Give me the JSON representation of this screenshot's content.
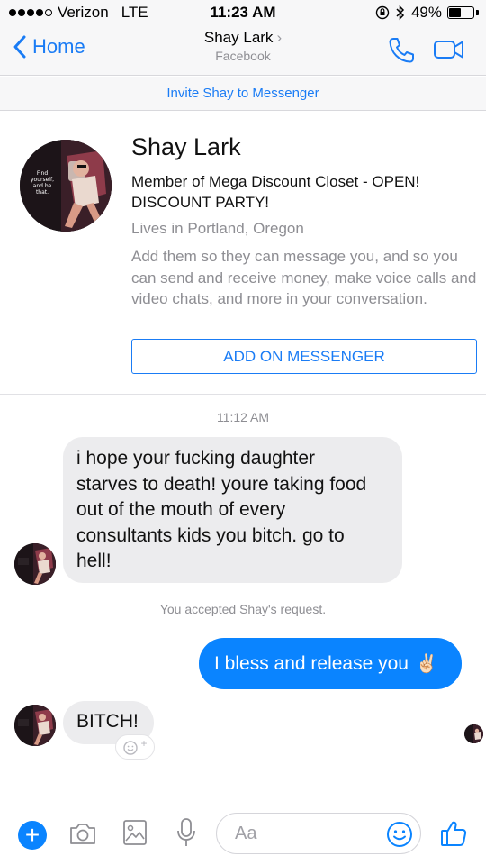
{
  "status_bar": {
    "carrier": "Verizon",
    "network": "LTE",
    "time": "11:23 AM",
    "battery_percent": "49%",
    "battery_level": 0.49,
    "signal_bars_filled": 4
  },
  "nav": {
    "back_label": "Home",
    "title": "Shay Lark",
    "chevron": "›",
    "subtitle": "Facebook",
    "accent_color": "#1a7cf5"
  },
  "invite": {
    "label": "Invite Shay to Messenger"
  },
  "profile": {
    "name": "Shay Lark",
    "member": "Member of Mega Discount Closet - OPEN! DISCOUNT PARTY!",
    "location": "Lives in Portland, Oregon",
    "description": "Add them so they can message you, and so you can send and receive money, make voice calls and video chats, and more in your conversation.",
    "add_button": "ADD ON MESSENGER",
    "avatar_text": "Find yourself, and be that."
  },
  "chat": {
    "timestamp": "11:12 AM",
    "messages": [
      {
        "direction": "incoming",
        "lines": [
          "i hope your fucking daughter",
          "starves to death! youre taking food",
          "out of the mouth of every",
          "consultants kids you bitch. go to",
          "hell!"
        ]
      },
      {
        "direction": "system",
        "text": "You accepted Shay's request."
      },
      {
        "direction": "outgoing",
        "text": "I bless and release you",
        "emoji": "✌🏻"
      },
      {
        "direction": "incoming",
        "text": "BITCH!"
      }
    ],
    "react_plus": "+"
  },
  "composer": {
    "placeholder": "Aa",
    "plus_label": "+",
    "icons": [
      "plus-icon",
      "camera-icon",
      "gallery-icon",
      "microphone-icon",
      "emoji-icon",
      "thumbs-up-icon"
    ]
  },
  "colors": {
    "messenger_blue": "#0a84ff",
    "incoming_bubble": "#ececee",
    "muted_text": "#8e8e93"
  }
}
